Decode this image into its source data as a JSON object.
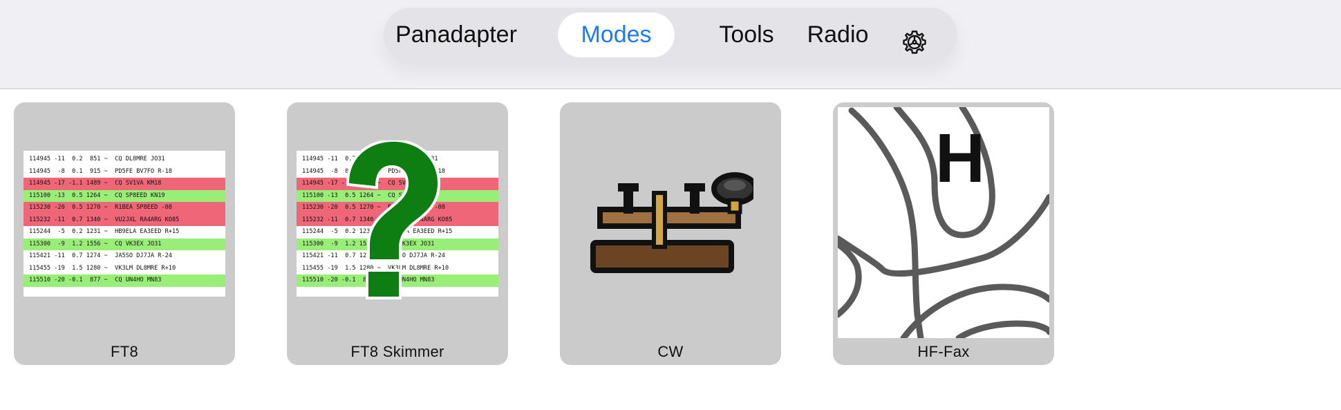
{
  "tabs": [
    {
      "label": "Panadapter",
      "active": false
    },
    {
      "label": "Modes",
      "active": true
    },
    {
      "label": "Tools",
      "active": false
    },
    {
      "label": "Radio",
      "active": false
    }
  ],
  "settings_icon": "gear-icon",
  "colors": {
    "accent": "#1a7cf5",
    "topbar_bg": "#efeff4",
    "card_bg": "#cbcbcb",
    "row_red": "#ee6677",
    "row_green": "#99ee77",
    "question_green": "#0e7d12"
  },
  "modes": [
    {
      "label": "FT8",
      "thumbnail": "ft8-decode-log"
    },
    {
      "label": "FT8 Skimmer",
      "thumbnail": "ft8-decode-log-with-question-mark"
    },
    {
      "label": "CW",
      "thumbnail": "telegraph-key-icon"
    },
    {
      "label": "HF-Fax",
      "thumbnail": "weather-map-isobars"
    }
  ],
  "ft8_log": [
    {
      "text": "114945 -11  0.2  851 ~  CQ DL8MRE JO31",
      "hl": ""
    },
    {
      "text": "114945  -8  0.1  915 ~  PD5FE BV7FO R-18",
      "hl": ""
    },
    {
      "text": "114945 -17 -1.1 1489 ~  CQ SV1VA KM18",
      "hl": "red"
    },
    {
      "text": "115100 -13  0.5 1264 ~  CQ SP8EED KN19",
      "hl": "green"
    },
    {
      "text": "115230 -20  0.5 1270 ~  R1BEA SP8EED -08",
      "hl": "red"
    },
    {
      "text": "115232 -11  0.7 1340 ~  VU2JXL RA4ARG KO85",
      "hl": "red"
    },
    {
      "text": "115244  -5  0.2 1231 ~  HB9ELA EA3EED R+15",
      "hl": ""
    },
    {
      "text": "115300  -9  1.2 1556 ~  CQ VK3EX JO31",
      "hl": "green"
    },
    {
      "text": "115421 -11  0.7 1274 ~  JA5SO DJ7JA R-24",
      "hl": ""
    },
    {
      "text": "115455 -19  1.5 1280 ~  VK3LM DL8MRE R+10",
      "hl": ""
    },
    {
      "text": "115510 -20 -0.1  877 ~  CQ UN4HO MN83",
      "hl": "green"
    }
  ],
  "fax_map_letter": "H"
}
